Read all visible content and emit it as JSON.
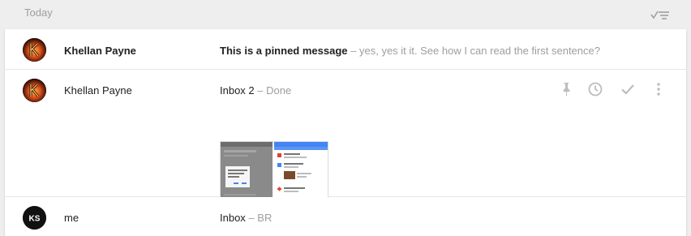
{
  "section": {
    "title": "Today"
  },
  "icons": {
    "sweep": "sweep-done-icon",
    "pin": "pin-icon",
    "snooze": "clock-icon",
    "done": "check-icon",
    "more": "more-vert-icon"
  },
  "colors": {
    "subject_muted": "#9e9e9e",
    "fab_red": "#db4437",
    "header_blue": "#4285f4"
  },
  "messages": [
    {
      "sender": "Khellan Payne",
      "subject": "This is a pinned message",
      "separator": "–",
      "snippet": "yes, yes it it. See how I can read the first sentence?",
      "pinned": true
    },
    {
      "sender": "Khellan Payne",
      "subject": "Inbox 2",
      "separator": "–",
      "snippet": "Done",
      "attachment": "image"
    },
    {
      "sender": "me",
      "subject": "Inbox",
      "separator": "–",
      "snippet": "BR",
      "avatar_text": "KS"
    }
  ]
}
